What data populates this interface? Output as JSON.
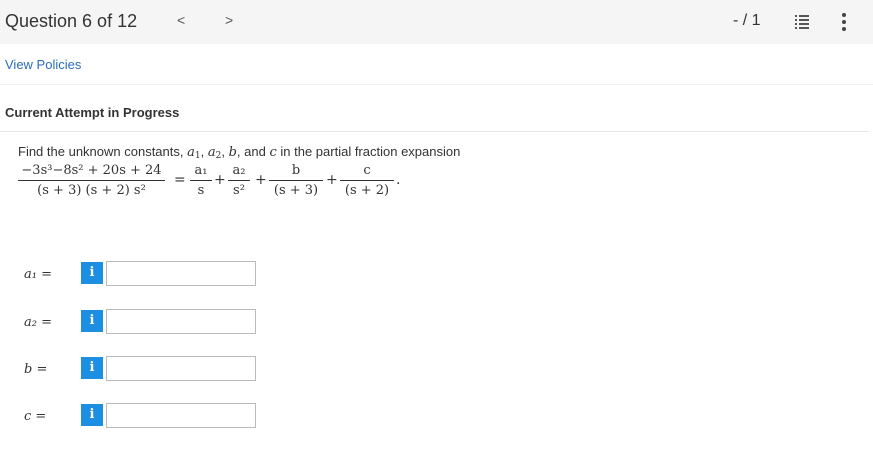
{
  "header": {
    "question_title": "Question 6 of 12",
    "prev_glyph": "<",
    "next_glyph": ">",
    "score": "- / 1",
    "list_icon": "question-list-icon",
    "more_icon": "vertical-ellipsis-icon"
  },
  "policy_link": "View Policies",
  "attempt_heading": "Current Attempt in Progress",
  "problem": {
    "prompt_before": "Find the unknown constants,",
    "prompt_after": "in the partial fraction expansion",
    "var_a1": "a",
    "var_a2": "a",
    "var_b": "b",
    "var_c": "c",
    "sub1": "1",
    "sub2": "2",
    "conj": "and",
    "lhs_numerator": "−3s³−8s² + 20s + 24",
    "lhs_denominator": "(s + 3) (s + 2) s²",
    "t1_num": "a₁",
    "t1_den": "s",
    "t2_num": "a₂",
    "t2_den": "s²",
    "t3_num": "b",
    "t3_den": "(s + 3)",
    "t4_num": "c",
    "t4_den": "(s + 2)",
    "equals": "=",
    "plus": "+",
    "period": "."
  },
  "answers": [
    {
      "label": "a₁ =",
      "info": "i",
      "value": ""
    },
    {
      "label": "a₂ =",
      "info": "i",
      "value": ""
    },
    {
      "label": "b =",
      "info": "i",
      "value": ""
    },
    {
      "label": "c =",
      "info": "i",
      "value": ""
    }
  ],
  "colors": {
    "accent": "#1d8fe3",
    "link": "#2a6ebb",
    "topbar": "#f5f5f5"
  }
}
